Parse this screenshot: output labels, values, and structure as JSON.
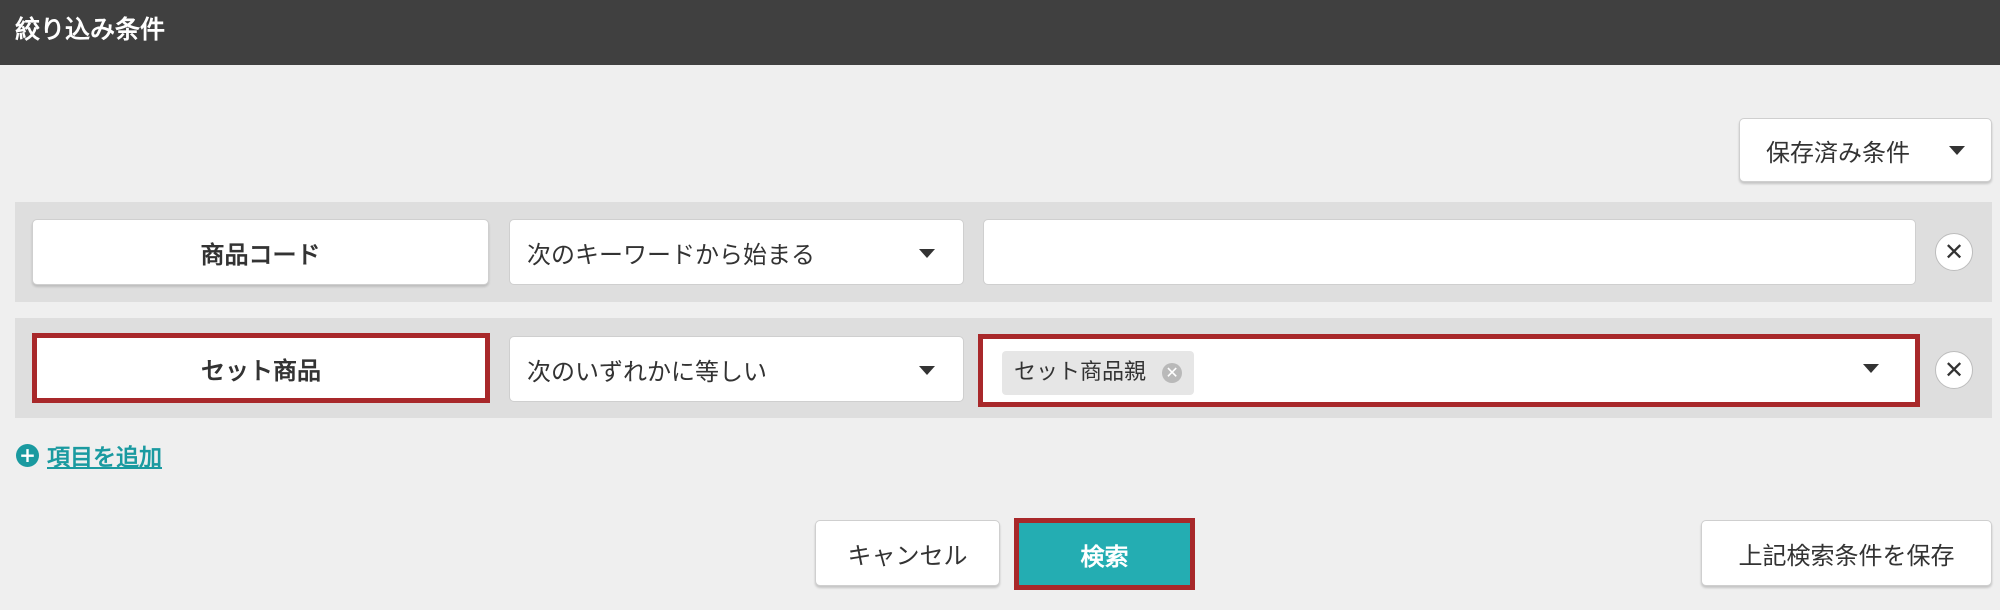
{
  "header": {
    "title": "絞り込み条件"
  },
  "saved_conditions": {
    "label": "保存済み条件"
  },
  "rows": [
    {
      "field": "商品コード",
      "operator": "次のキーワードから始まる",
      "value": ""
    },
    {
      "field": "セット商品",
      "operator": "次のいずれかに等しい",
      "tag": "セット商品親"
    }
  ],
  "add_item": {
    "label": "項目を追加"
  },
  "footer": {
    "cancel_label": "キャンセル",
    "search_label": "検索",
    "save_label": "上記検索条件を保存"
  },
  "colors": {
    "header_bg": "#404040",
    "accent": "#24adb2",
    "link": "#1a9aa0",
    "highlight": "#a8282a"
  },
  "icons": {
    "caret": "triangle-down-icon",
    "remove": "close-icon",
    "add": "plus-circle-icon",
    "tag_remove": "close-circle-icon"
  }
}
